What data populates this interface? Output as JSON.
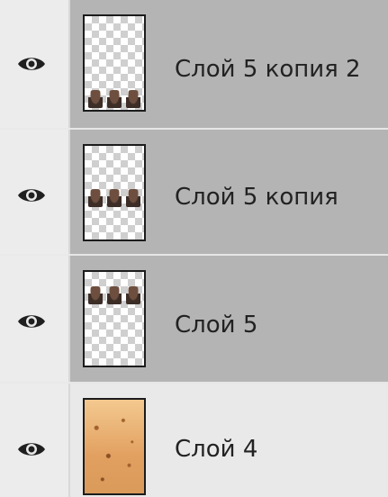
{
  "layers_panel": {
    "layers": [
      {
        "name": "Слой 5 копия 2",
        "visible": true,
        "selected": true,
        "thumbnail": "transparent-with-figures-bottom"
      },
      {
        "name": "Слой 5 копия",
        "visible": true,
        "selected": true,
        "thumbnail": "transparent-with-figures-middle"
      },
      {
        "name": "Слой 5",
        "visible": true,
        "selected": true,
        "thumbnail": "transparent-with-figures-top"
      },
      {
        "name": "Слой 4",
        "visible": true,
        "selected": false,
        "thumbnail": "textured-paper"
      }
    ]
  },
  "icons": {
    "visibility": "eye-icon"
  },
  "colors": {
    "selected_row": "#b4b4b4",
    "panel_bg": "#e9e9e9"
  }
}
